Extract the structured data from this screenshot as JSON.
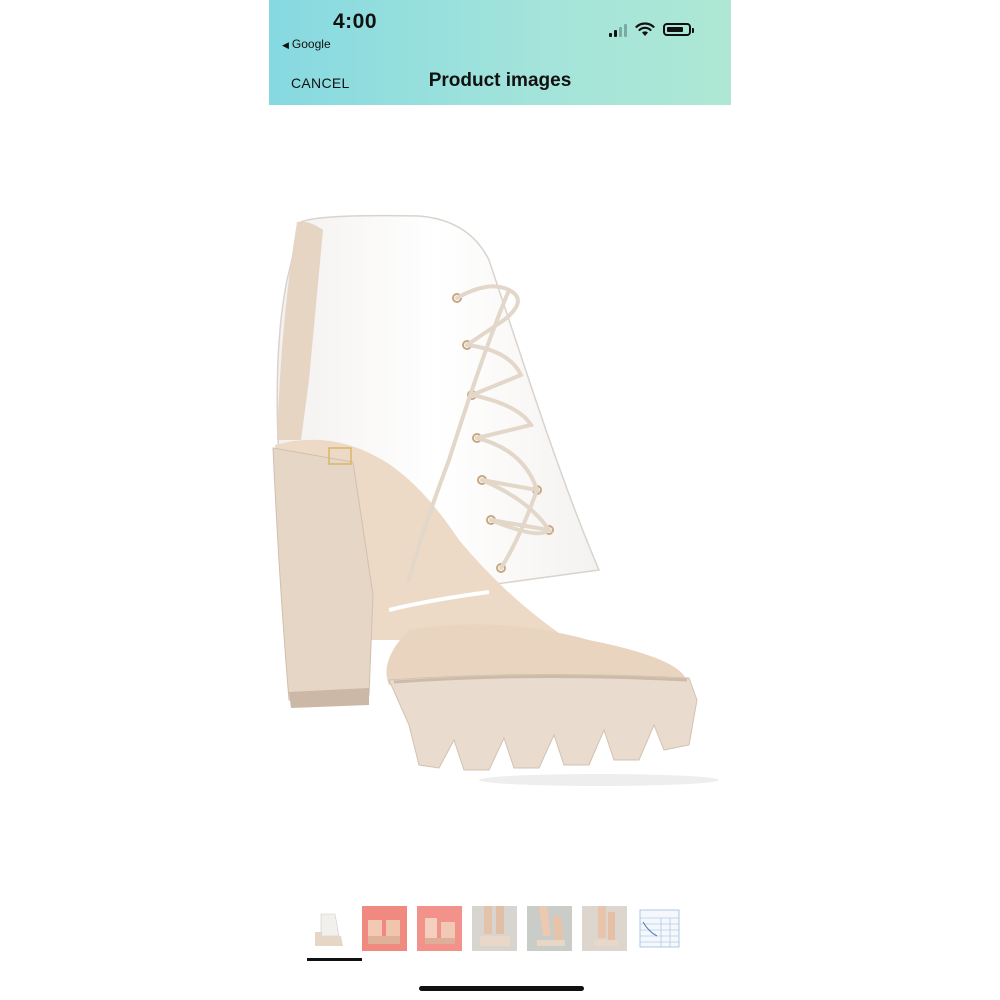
{
  "status_bar": {
    "time": "4:00",
    "back_app": "Google",
    "back_icon": "back-triangle-icon",
    "battery_level": 0.8
  },
  "nav": {
    "cancel_label": "CANCEL",
    "title": "Product images"
  },
  "gallery": {
    "selected_index": 0,
    "thumbnail_count": 7
  },
  "colors": {
    "header_gradient_start": "#86d9e1",
    "header_gradient_end": "#aee8d4",
    "shoe_nude": "#e8d8c8",
    "thumb_pink": "#f08a80"
  }
}
